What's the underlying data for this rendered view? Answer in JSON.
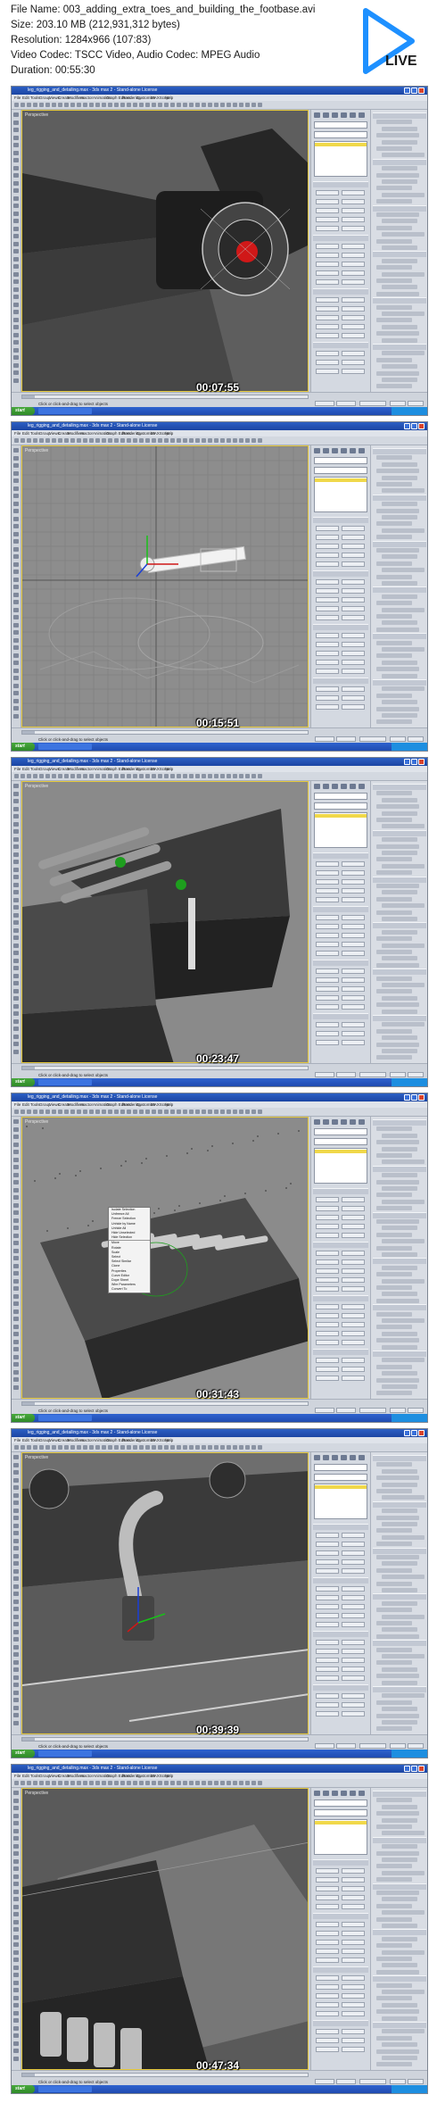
{
  "header": {
    "file_name": "File Name: 003_adding_extra_toes_and_building_the_footbase.avi",
    "size": "Size: 203.10 MB (212,931,312 bytes)",
    "resolution": "Resolution: 1284x966 (107:83)",
    "codec": "Video Codec: TSCC Video, Audio Codec: MPEG Audio",
    "duration": "Duration: 00:55:30",
    "badge": "LIVE",
    "badge_icon": "play-triangle-icon",
    "badge_color": "#1e90ff"
  },
  "app": {
    "window_title": "leg_rigging_and_detailing.max - 3ds max 2 - Stand-alone License",
    "menus": [
      "File",
      "Edit",
      "Tools",
      "Group",
      "Views",
      "Create",
      "Modifiers",
      "reactor",
      "Animation",
      "Graph Editors",
      "Rendering",
      "Customize",
      "MAXScript",
      "Help"
    ],
    "viewport_label": "Perspective",
    "status_hint": "Click or click-and-drag to select objects",
    "start_label": "start"
  },
  "frames": [
    {
      "time": "00:07:55",
      "scene": "closeup-red-joint"
    },
    {
      "time": "00:15:51",
      "scene": "grid-wireframe"
    },
    {
      "time": "00:23:47",
      "scene": "wing-claws"
    },
    {
      "time": "00:31:43",
      "scene": "context-menu"
    },
    {
      "time": "00:39:39",
      "scene": "hose-pipe"
    },
    {
      "time": "00:47:34",
      "scene": "plate-angle"
    }
  ],
  "context_menu": {
    "items": [
      "Isolate Selection",
      "Unfreeze All",
      "Freeze Selection",
      "Unhide by Name",
      "Unhide All",
      "Hide Unselected",
      "Hide Selection",
      "Move",
      "Rotate",
      "Scale",
      "Select",
      "Select Similar",
      "Clone",
      "Properties",
      "Curve Editor",
      "Dope Sheet",
      "Wire Parameters",
      "Convert To"
    ]
  }
}
